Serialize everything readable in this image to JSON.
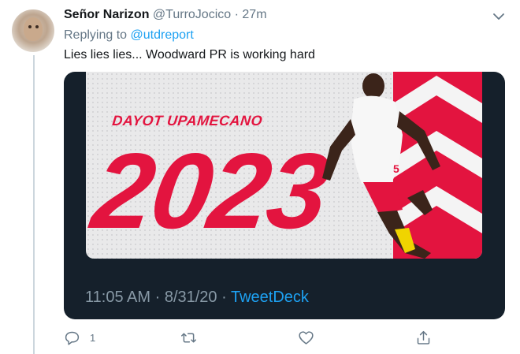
{
  "tweet": {
    "display_name": "Señor Narizon",
    "handle": "@TurroJocico",
    "separator": "·",
    "time_ago": "27m",
    "replying_prefix": "Replying to",
    "replying_handle": "@utdreport",
    "text": "Lies lies lies... Woodward PR is working hard"
  },
  "quoted_card": {
    "image": {
      "player_name": "DAYOT UPAMECANO",
      "year": "2023",
      "jersey_number": "5",
      "accent_color": "#e3143f"
    },
    "time": "11:05 AM",
    "separator": "·",
    "date": "8/31/20",
    "separator2": "·",
    "source": "TweetDeck"
  },
  "actions": {
    "reply_count": "1",
    "retweet_count": "",
    "like_count": ""
  },
  "icons": [
    "chevron-down-icon",
    "reply-icon",
    "retweet-icon",
    "like-icon",
    "share-icon"
  ]
}
